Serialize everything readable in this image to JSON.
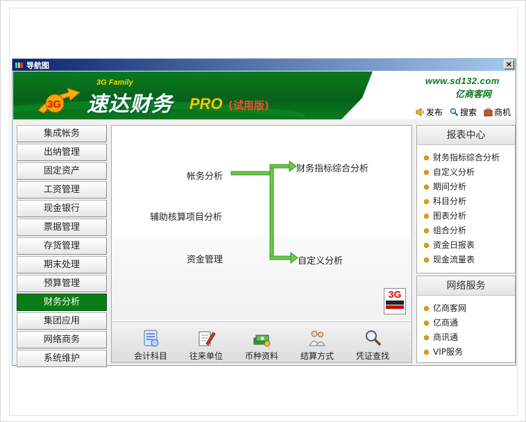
{
  "window": {
    "title": "导航图",
    "close_label": "×"
  },
  "banner": {
    "brand_sub": "3G Family",
    "brand_name": "速达财务",
    "brand_pro": "PRO",
    "brand_trial": "(试用版)",
    "site_url": "www.sd132.com",
    "site_name": "亿商客网",
    "links": [
      {
        "label": "发布",
        "icon": "speaker-icon"
      },
      {
        "label": "搜索",
        "icon": "search-icon"
      },
      {
        "label": "商机",
        "icon": "briefcase-icon"
      }
    ]
  },
  "leftnav": {
    "items": [
      "集成帐务",
      "出纳管理",
      "固定资产",
      "工资管理",
      "现金银行",
      "票据管理",
      "存货管理",
      "期末处理",
      "预算管理",
      "财务分析",
      "集团应用",
      "网络商务",
      "系统维护"
    ],
    "active": "财务分析"
  },
  "flow": {
    "source_1": "帐务分析",
    "source_2": "辅助核算项目分析",
    "source_3": "资金管理",
    "target_1": "财务指标综合分析",
    "target_2": "自定义分析",
    "seal_text": "3G"
  },
  "toolbar": [
    {
      "label": "会计科目",
      "icon": "account-book-icon"
    },
    {
      "label": "往来单位",
      "icon": "document-pen-icon"
    },
    {
      "label": "币种资料",
      "icon": "money-stack-icon"
    },
    {
      "label": "结算方式",
      "icon": "people-icon"
    },
    {
      "label": "凭证查找",
      "icon": "magnifier-icon"
    }
  ],
  "reports": {
    "title": "报表中心",
    "items": [
      "财务指标综合分析",
      "自定义分析",
      "期间分析",
      "科目分析",
      "图表分析",
      "组合分析",
      "资金日报表",
      "现金流量表"
    ]
  },
  "network": {
    "title": "网络服务",
    "items": [
      "亿商客网",
      "亿商通",
      "商讯通",
      "VIP服务"
    ]
  },
  "colors": {
    "brand_green": "#0a7a1e",
    "active_nav": "#0b7d18",
    "arrow_green": "#5cc13a",
    "bullet": "#f0a000"
  }
}
